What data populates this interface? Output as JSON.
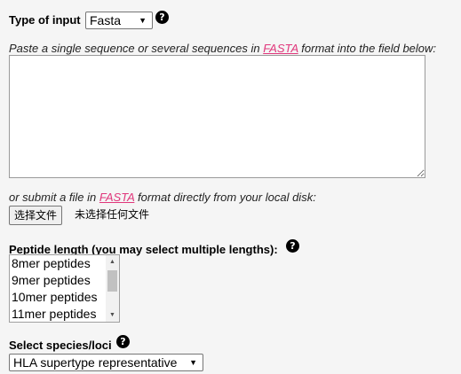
{
  "input_type": {
    "label": "Type of input",
    "selected": "Fasta",
    "arrow_icon": "▼",
    "help_icon": "?"
  },
  "paste_instruction": {
    "before": "Paste a single sequence or several sequences in ",
    "link": "FASTA",
    "after": " format into the field below:"
  },
  "sequence_textarea": {
    "value": ""
  },
  "file_instruction": {
    "before": "or submit a file in ",
    "link": "FASTA",
    "after": " format directly from your local disk:"
  },
  "file_upload": {
    "button_label": "选择文件",
    "status": "未选择任何文件"
  },
  "peptide_length": {
    "label": "Peptide length (you may select multiple lengths):",
    "help_icon": "?",
    "options": [
      "8mer peptides",
      "9mer peptides",
      "10mer peptides",
      "11mer peptides"
    ],
    "scroll_up_icon": "▲",
    "scroll_down_icon": "▼"
  },
  "species": {
    "label": "Select species/loci",
    "help_icon": "?",
    "selected": "HLA supertype representative",
    "arrow_icon": "▼"
  }
}
